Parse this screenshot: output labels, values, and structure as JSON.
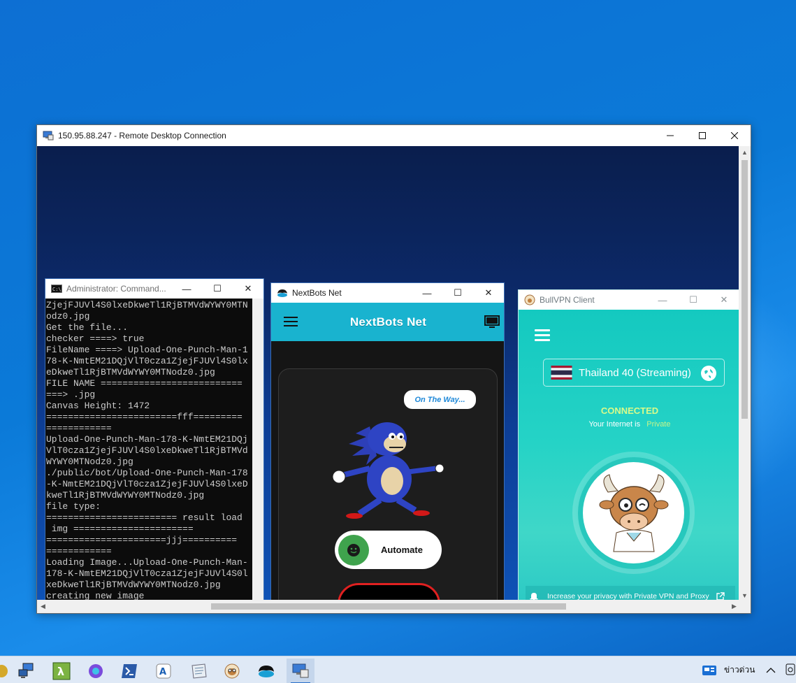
{
  "rdp_window": {
    "title": "150.95.88.247 - Remote Desktop Connection"
  },
  "cmd_window": {
    "title": "Administrator: Command...",
    "lines": [
      "ZjejFJUVl4S0lxeDkweTl1RjBTMVdWYWY0MTN",
      "odz0.jpg",
      "Get the file...",
      "checker ====> true",
      "FileName ====> Upload-One-Punch-Man-1",
      "78-K-NmtEM21DQjVlT0cza1ZjejFJUVl4S0lx",
      "eDkweTl1RjBTMVdWYWY0MTNodz0.jpg",
      "FILE NAME ==========================",
      "===> .jpg",
      "Canvas Height: 1472",
      "========================fff=========",
      "============",
      "Upload-One-Punch-Man-178-K-NmtEM21DQj",
      "VlT0cza1ZjejFJUVl4S0lxeDkweTl1RjBTMVd",
      "WYWY0MTNodz0.jpg",
      "./public/bot/Upload-One-Punch-Man-178",
      "-K-NmtEM21DQjVlT0cza1ZjejFJUVl4S0lxeD",
      "kweTl1RjBTMVdWYWY0MTNodz0.jpg",
      "file type:",
      "======================== result load",
      " img ======================",
      "======================jjj==========",
      "============",
      "Loading Image...Upload-One-Punch-Man-",
      "178-K-NmtEM21DQjVlT0cza1ZjejFJUVl4S0l",
      "xeDkweTl1RjBTMVdWYWY0MTNodz0.jpg",
      "creating new image"
    ]
  },
  "nextbots_window": {
    "title": "NextBots Net",
    "header_title": "NextBots Net",
    "bubble_text": "On The Way...",
    "automate_label": "Automate"
  },
  "vpn_window": {
    "title": "BullVPN Client",
    "location": "Thailand 40 (Streaming)",
    "status": "CONNECTED",
    "internet_prefix": "Your Internet is",
    "internet_state": "Private",
    "footer_text": "Increase your privacy with Private VPN and Proxy"
  },
  "taskbar": {
    "news_label": "ข่าวด่วน"
  },
  "colors": {
    "nextbots_header": "#19b3cf",
    "vpn_teal": "#14c9c0",
    "connected_green": "#d8fa8a",
    "automate_knob": "#3fa34d"
  }
}
